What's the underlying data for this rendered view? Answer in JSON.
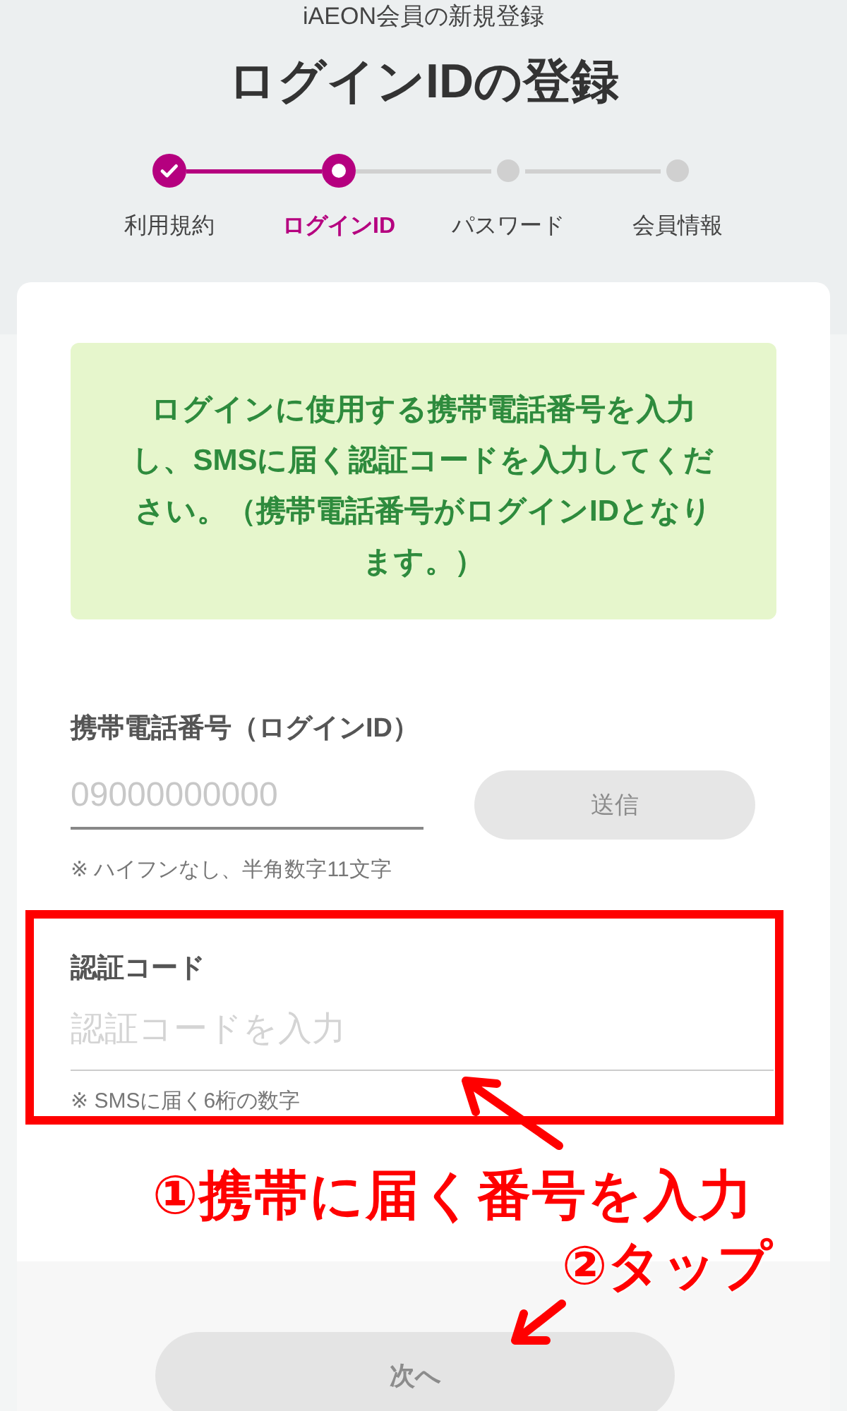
{
  "header": {
    "subtitle": "iAEON会員の新規登録",
    "title": "ログインIDの登録"
  },
  "steps": [
    {
      "label": "利用規約",
      "done": true,
      "selected": false
    },
    {
      "label": "ログインID",
      "done": false,
      "selected": true
    },
    {
      "label": "パスワード",
      "done": false,
      "selected": false
    },
    {
      "label": "会員情報",
      "done": false,
      "selected": false
    }
  ],
  "notice": "ログインに使用する携帯電話番号を入力し、SMSに届く認証コードを入力してください。（携帯電話番号がログインIDとなります。）",
  "phone": {
    "label": "携帯電話番号（ログインID）",
    "placeholder": "09000000000",
    "hint": "※ ハイフンなし、半角数字11文字",
    "send_button": {
      "label": "送信",
      "disabled": true
    }
  },
  "code": {
    "label": "認証コード",
    "placeholder": "認証コードを入力",
    "hint": "※ SMSに届く6桁の数字",
    "highlighted": true
  },
  "next_button": {
    "label": "次へ",
    "disabled": true
  },
  "annotations": [
    {
      "text": "①携帯に届く番号を入力"
    },
    {
      "text": "②タップ"
    }
  ]
}
